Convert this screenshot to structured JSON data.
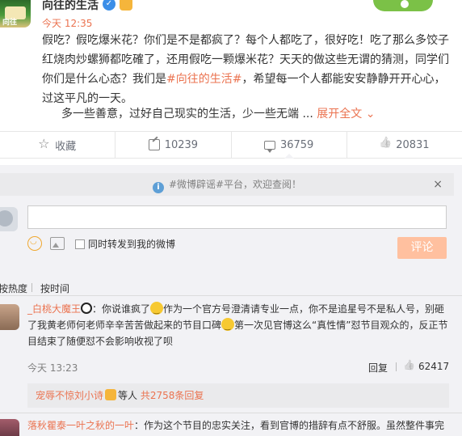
{
  "post": {
    "author": "向往的生活",
    "time": "今天 12:35",
    "avatar_text": "向往",
    "content_pre": "假吃？假吃爆米花？你们是不是都疯了？每个人都吃了，很好吃！吃了那么多饺子红烧肉炒螺狮都吃確了，还用假吃一颗爆米花？天天的做这些无谓的猜测，同学们你们是什么心态？我们是",
    "content_topic": "#向往的生活#",
    "content_post": "，希望每一个人都能安安静静开开心心，过这平凡的一天。",
    "content_line2": "多一些善意，过好自己现实的生活，少一些无端 ...",
    "expand_label": "展开全文",
    "expand_icon": "chevron-down-icon"
  },
  "actions": {
    "favorite_label": "收藏",
    "repost_count": "10239",
    "comment_count": "36759",
    "like_count": "20831"
  },
  "comments_section": {
    "notice_text": "#微博辟谣#平台，欢迎查阅！",
    "notice_close": "×",
    "input_value": "",
    "repost_checkbox_label": "同时转发到我的微博",
    "submit_label": "评论",
    "sort_hot": "按热度",
    "sort_time": "按时间"
  },
  "comments": [
    {
      "username": "_白桃大魔王",
      "text_a": "：你说谁疯了",
      "text_b": "作为一个官方号澄清请专业一点，你不是追星号不是私人号，别砸了我黄老师何老师辛辛苦苦做起来的节目口碑",
      "text_c": "第一次见官博这么“真性情”怼节目观众的，反正节目结束了随便怼不会影响收视了呗",
      "time": "今天 13:23",
      "reply_label": "回复",
      "like_count": "62417",
      "sub_reply": {
        "user": "宠辱不惊刘小诗",
        "middle": "等人",
        "count_text": "共2758条回复"
      }
    },
    {
      "username": "落秋瞿泰一叶之秋的一叶",
      "text": "：作为这个节目的忠实关注，看到官博的措辞有点不舒服。虽然整件事完"
    }
  ],
  "colors": {
    "accent": "#eb7350",
    "link": "#eb7350",
    "background_comments": "#f2f2f5",
    "submit_disabled": "#ffc09f"
  }
}
